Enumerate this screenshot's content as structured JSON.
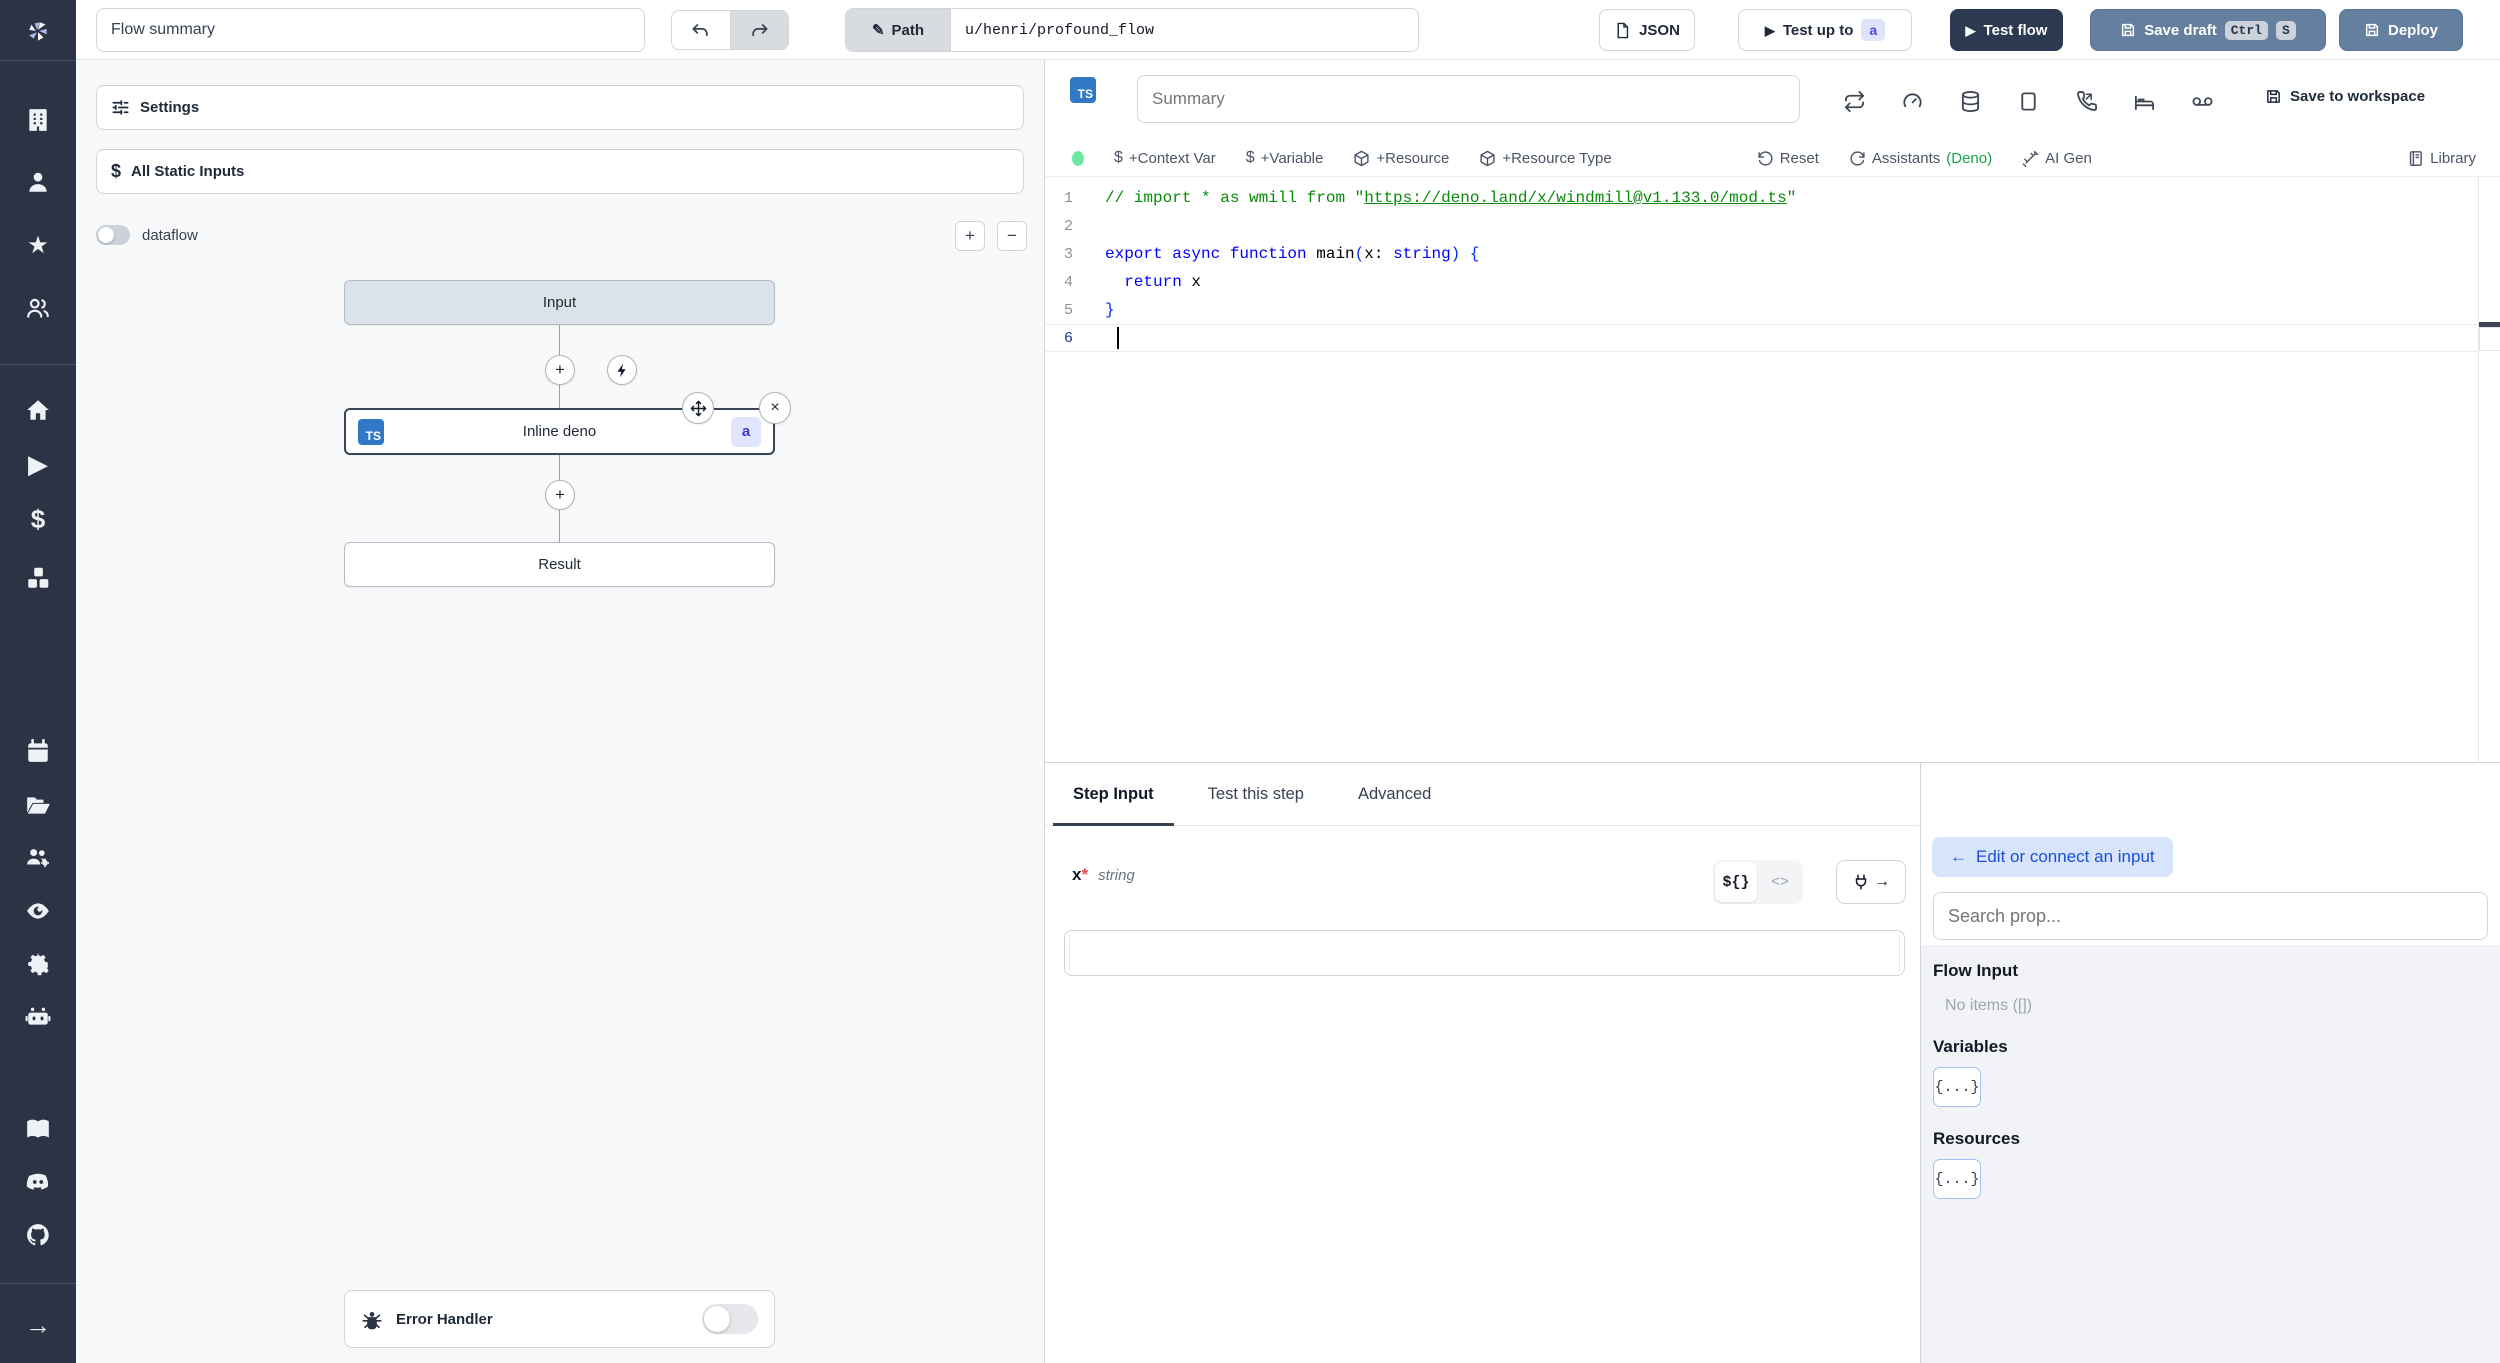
{
  "topbar": {
    "flow_summary": "Flow summary",
    "path_label": "Path",
    "path_value": "u/henri/profound_flow",
    "json_button": "JSON",
    "test_up_to": "Test up to",
    "test_up_to_badge": "a",
    "test_flow": "Test flow",
    "save_draft": "Save draft",
    "kbd": [
      "Ctrl",
      "S"
    ],
    "deploy": "Deploy"
  },
  "sidebar": {
    "icons": [
      "windmill-logo",
      "building",
      "user",
      "star",
      "user-group",
      "home",
      "play",
      "dollar",
      "cubes",
      "calendar",
      "folder",
      "user-group-gear",
      "eye",
      "gear",
      "robot",
      "book",
      "discord",
      "github",
      "arrow-right"
    ]
  },
  "flow_panel": {
    "settings": "Settings",
    "all_static_inputs": "All Static Inputs",
    "dataflow_label": "dataflow",
    "zoom_in": "+",
    "zoom_out": "−",
    "nodes": {
      "input": "Input",
      "step_label": "Inline deno",
      "step_lang_badge": "TS",
      "step_id_badge": "a",
      "result": "Result"
    },
    "error_handler": "Error Handler"
  },
  "editor": {
    "lang_badge": "TS",
    "summary_placeholder": "Summary",
    "save_to_workspace": "Save to workspace",
    "header_icons": [
      "repeat",
      "gauge",
      "database",
      "square",
      "phone-incoming",
      "bed",
      "voicemail"
    ],
    "toolbar": {
      "context_var_icon": "$",
      "context_var": "+Context Var",
      "variable_icon": "$",
      "variable": "+Variable",
      "resource": "+Resource",
      "resource_type": "+Resource Type",
      "reset": "Reset",
      "assistants": "Assistants",
      "assistants_lang": "(Deno)",
      "ai_gen": "AI Gen",
      "library": "Library"
    },
    "code": {
      "line_numbers": [
        "1",
        "2",
        "3",
        "4",
        "5",
        "6"
      ],
      "lines": [
        {
          "tokens": [
            {
              "text": "// import * as wmill from \""
            },
            {
              "text": "https://deno.land/x/windmill@v1.133.0/mod.ts"
            },
            {
              "text": "\""
            }
          ]
        },
        {
          "tokens": [
            {
              "text": ""
            }
          ]
        },
        {
          "tokens": [
            {
              "text": "export async function "
            },
            {
              "text": "main"
            },
            {
              "text": "("
            },
            {
              "text": "x"
            },
            {
              "text": ": "
            },
            {
              "text": "string"
            },
            {
              "text": ") {"
            }
          ]
        },
        {
          "tokens": [
            {
              "text": "  return"
            },
            {
              "text": " x"
            }
          ]
        },
        {
          "tokens": [
            {
              "text": "}"
            }
          ]
        },
        {
          "tokens": [
            {
              "text": ""
            }
          ]
        }
      ]
    }
  },
  "step_panel": {
    "tabs": [
      "Step Input",
      "Test this step",
      "Advanced"
    ],
    "field_name": "x",
    "required_mark": "*",
    "field_type": "string",
    "toggle_template": "${}",
    "toggle_code": "<>",
    "plug_arrow": "→"
  },
  "connect_panel": {
    "edit_button_arrow": "←",
    "edit_button": "Edit or connect an input",
    "search_placeholder": "Search prop...",
    "flow_input_title": "Flow Input",
    "flow_input_empty": "No items ([])",
    "variables_title": "Variables",
    "variables_button": "{...}",
    "resources_title": "Resources",
    "resources_button": "{...}"
  },
  "colors": {
    "sidebar_bg": "#2b3344",
    "steel_button": "#65809f",
    "dark_button": "#2c3950",
    "ts_badge": "#3178c6",
    "id_badge_bg": "#e0e4fc",
    "id_badge_text": "#4338ca",
    "deno_green": "#16a34a",
    "status_dot": "#6ee7a0",
    "accent_blue": "#1d4ed8"
  }
}
